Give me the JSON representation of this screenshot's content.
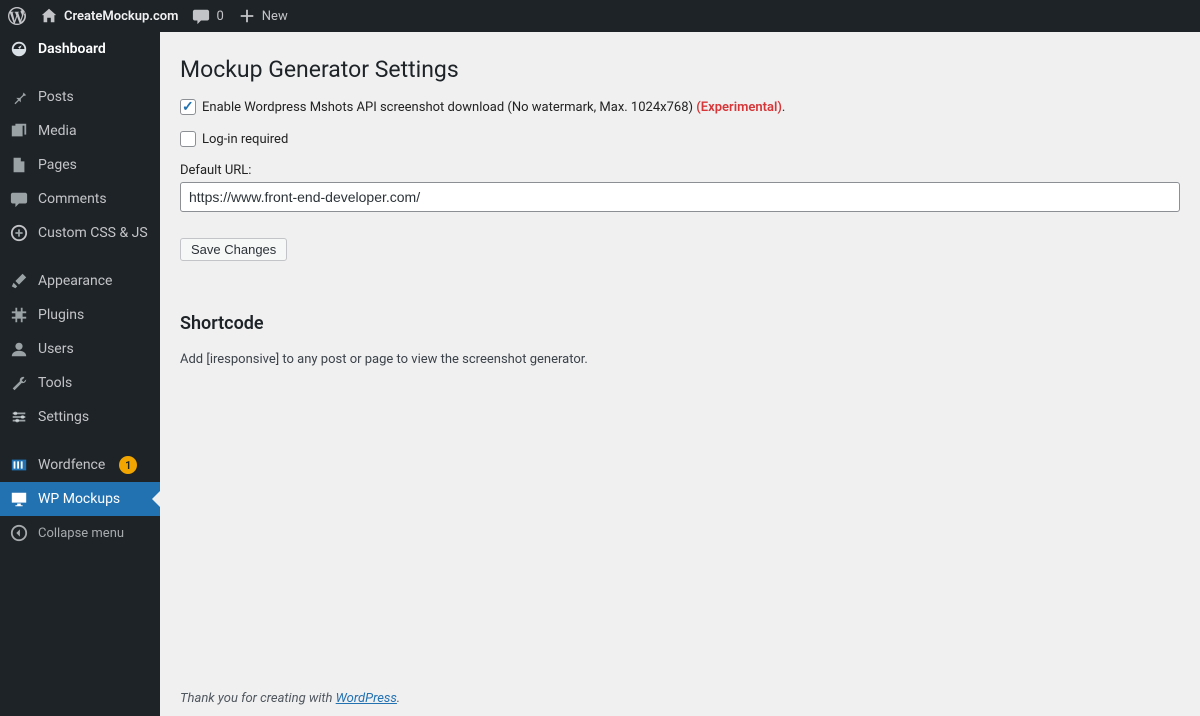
{
  "adminbar": {
    "site_name": "CreateMockup.com",
    "comments_count": "0",
    "new_label": "New"
  },
  "sidebar": {
    "dashboard": "Dashboard",
    "posts": "Posts",
    "media": "Media",
    "pages": "Pages",
    "comments": "Comments",
    "custom_css": "Custom CSS & JS",
    "appearance": "Appearance",
    "plugins": "Plugins",
    "users": "Users",
    "tools": "Tools",
    "settings": "Settings",
    "wordfence": "Wordfence",
    "wordfence_badge": "1",
    "wp_mockups": "WP Mockups",
    "collapse": "Collapse menu"
  },
  "page": {
    "title": "Mockup Generator Settings",
    "enable_mshots_label": "Enable Wordpress Mshots API screenshot download (No watermark, Max. 1024x768)",
    "experimental": "(Experimental)",
    "login_required_label": "Log-in required",
    "default_url_label": "Default URL:",
    "default_url_value": "https://www.front-end-developer.com/",
    "save_button": "Save Changes",
    "shortcode_title": "Shortcode",
    "shortcode_desc": "Add [iresponsive] to any post or page to view the screenshot generator."
  },
  "footer": {
    "text": "Thank you for creating with ",
    "link": "WordPress",
    "period": "."
  }
}
